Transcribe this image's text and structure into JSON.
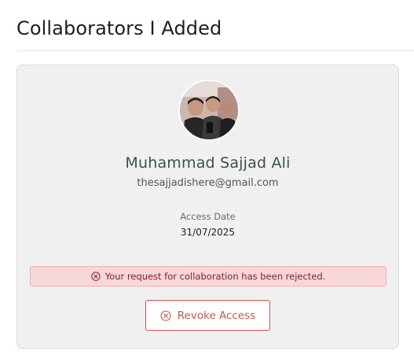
{
  "page": {
    "title": "Collaborators I Added"
  },
  "collaborator": {
    "name": "Muhammad Sajjad Ali",
    "email": "thesajjadishere@gmail.com",
    "access_label": "Access Date",
    "access_date": "31/07/2025",
    "avatar_icon": "profile-photo"
  },
  "alert": {
    "icon": "x-circle-icon",
    "message": "Your request for collaboration has been rejected.",
    "color": "#842029",
    "background": "#f8d7da"
  },
  "actions": {
    "revoke_label": "Revoke Access",
    "revoke_icon": "x-circle-icon",
    "revoke_color": "#d9534f"
  }
}
